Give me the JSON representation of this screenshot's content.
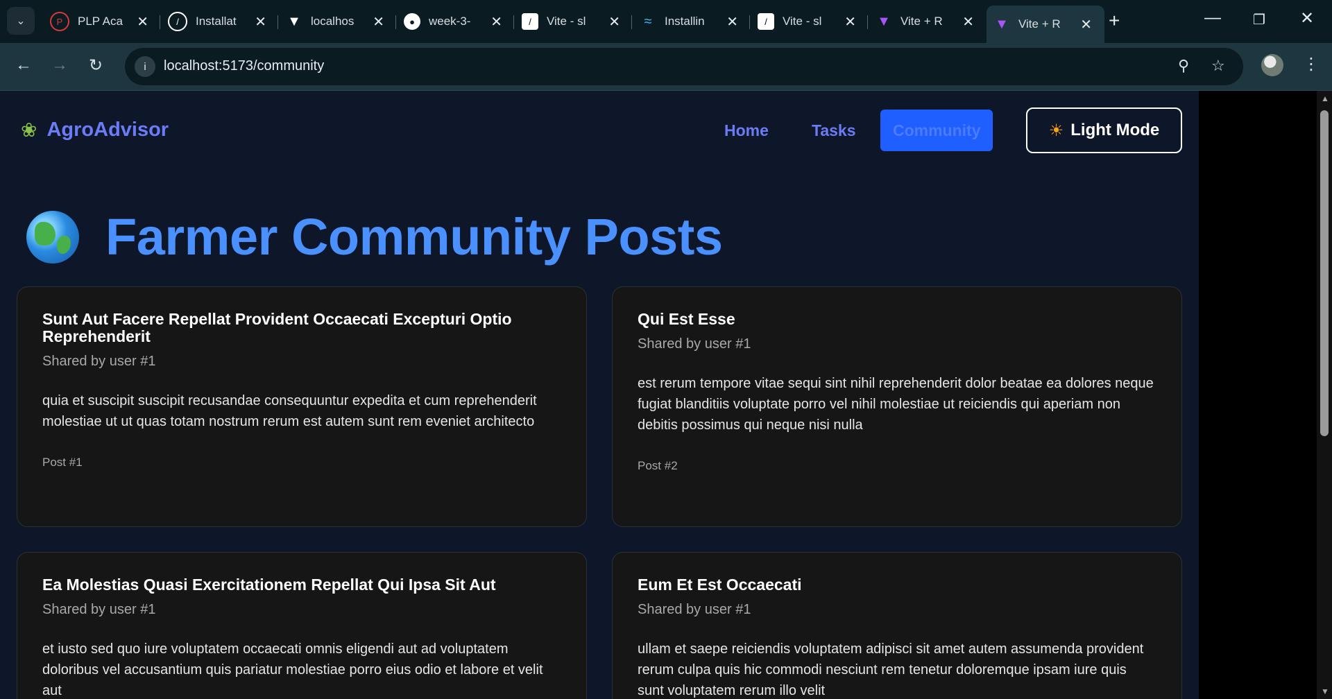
{
  "browser": {
    "tabs": [
      {
        "label": "PLP Aca",
        "icon": "plp-icon",
        "color": "#d83a3a"
      },
      {
        "label": "Installat",
        "icon": "shadcn-icon",
        "color": "#ffffff"
      },
      {
        "label": "localhos",
        "icon": "vite-icon",
        "color": "#ffffff"
      },
      {
        "label": "week-3-",
        "icon": "github-icon",
        "color": "#ffffff"
      },
      {
        "label": "Vite - sl",
        "icon": "shadcn-icon",
        "color": "#ffffff"
      },
      {
        "label": "Installin",
        "icon": "tailwind-icon",
        "color": "#38bdf8"
      },
      {
        "label": "Vite - sl",
        "icon": "shadcn-icon",
        "color": "#ffffff"
      },
      {
        "label": "Vite + R",
        "icon": "vite-icon",
        "color": "#a855f7"
      },
      {
        "label": "Vite + R",
        "icon": "vite-icon",
        "color": "#a855f7",
        "active": true
      }
    ],
    "url": "localhost:5173/community"
  },
  "app": {
    "brand": "AgroAdvisor",
    "nav": {
      "home": "Home",
      "tasks": "Tasks",
      "community": "Community",
      "active": "community"
    },
    "mode_button": "Light Mode"
  },
  "page": {
    "title": "Farmer Community Posts",
    "posts": [
      {
        "title": "Sunt Aut Facere Repellat Provident Occaecati Excepturi Optio Reprehenderit",
        "author": "Shared by user #1",
        "body": "quia et suscipit suscipit recusandae consequuntur expedita et cum reprehenderit molestiae ut ut quas totam nostrum rerum est autem sunt rem eveniet architecto",
        "footer": "Post #1"
      },
      {
        "title": "Qui Est Esse",
        "author": "Shared by user #1",
        "body": "est rerum tempore vitae sequi sint nihil reprehenderit dolor beatae ea dolores neque fugiat blanditiis voluptate porro vel nihil molestiae ut reiciendis qui aperiam non debitis possimus qui neque nisi nulla",
        "footer": "Post #2"
      },
      {
        "title": "Ea Molestias Quasi Exercitationem Repellat Qui Ipsa Sit Aut",
        "author": "Shared by user #1",
        "body": "et iusto sed quo iure voluptatem occaecati omnis eligendi aut ad voluptatem doloribus vel accusantium quis pariatur molestiae porro eius odio et labore et velit aut",
        "footer": ""
      },
      {
        "title": "Eum Et Est Occaecati",
        "author": "Shared by user #1",
        "body": "ullam et saepe reiciendis voluptatem adipisci sit amet autem assumenda provident rerum culpa quis hic commodi nesciunt rem tenetur doloremque ipsam iure quis sunt voluptatem rerum illo velit",
        "footer": ""
      }
    ]
  }
}
